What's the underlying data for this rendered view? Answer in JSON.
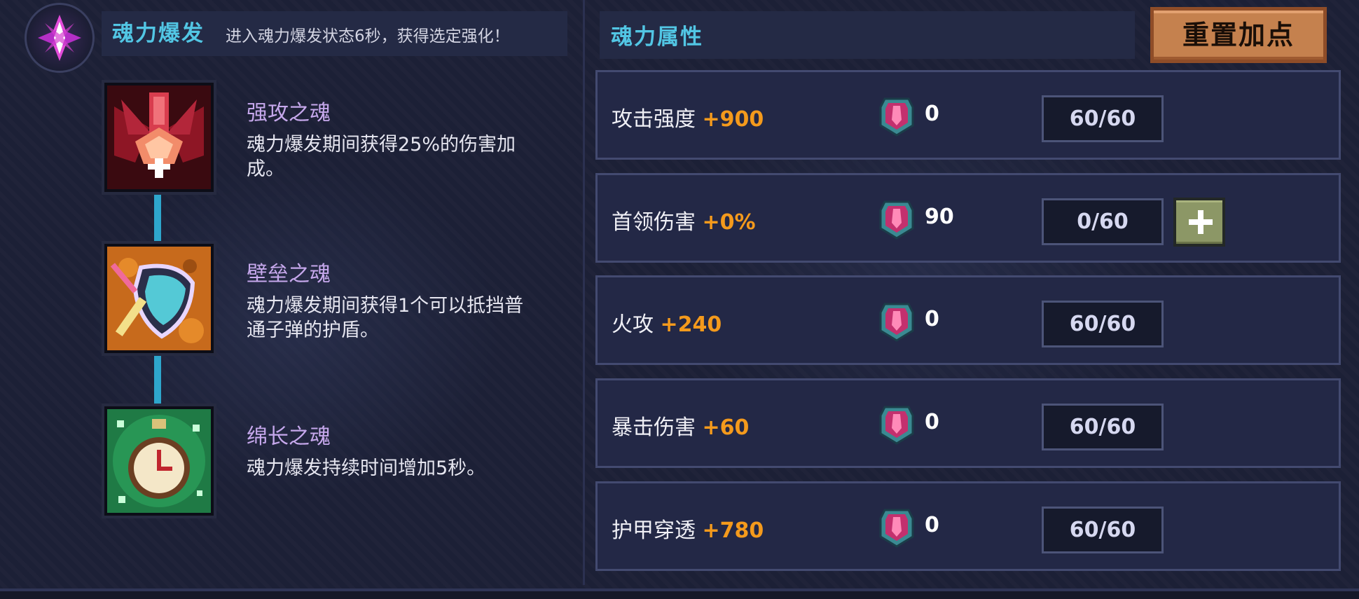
{
  "burst": {
    "title": "魂力爆发",
    "description": "进入魂力爆发状态6秒，获得选定强化！"
  },
  "skills": [
    {
      "name": "强攻之魂",
      "desc_line1": "魂力爆发期间获得25%的伤害加",
      "desc_line2": "成。",
      "icon": "red-fighter-ship-icon"
    },
    {
      "name": "壁垒之魂",
      "desc_line1": "魂力爆发期间获得1个可以抵挡普",
      "desc_line2": "通子弹的护盾。",
      "icon": "shield-sword-icon"
    },
    {
      "name": "绵长之魂",
      "desc_line1": "魂力爆发持续时间增加5秒。",
      "desc_line2": "",
      "icon": "stopwatch-icon"
    }
  ],
  "attributes_panel": {
    "title": "魂力属性",
    "reset_label": "重置加点"
  },
  "attributes": [
    {
      "name": "攻击强度",
      "bonus": "+900",
      "cost": "0",
      "level": "60/60",
      "can_add": false
    },
    {
      "name": "首领伤害",
      "bonus": "+0%",
      "cost": "90",
      "level": "0/60",
      "can_add": true
    },
    {
      "name": "火攻",
      "bonus": "+240",
      "cost": "0",
      "level": "60/60",
      "can_add": false
    },
    {
      "name": "暴击伤害",
      "bonus": "+60",
      "cost": "0",
      "level": "60/60",
      "can_add": false
    },
    {
      "name": "护甲穿透",
      "bonus": "+780",
      "cost": "0",
      "level": "60/60",
      "can_add": false
    }
  ],
  "colors": {
    "accent": "#52c6e4",
    "bonus": "#f49a1c",
    "skill_name": "#c6a8ec",
    "reset_button": "#c5814e",
    "plus_button": "#8c9766"
  }
}
